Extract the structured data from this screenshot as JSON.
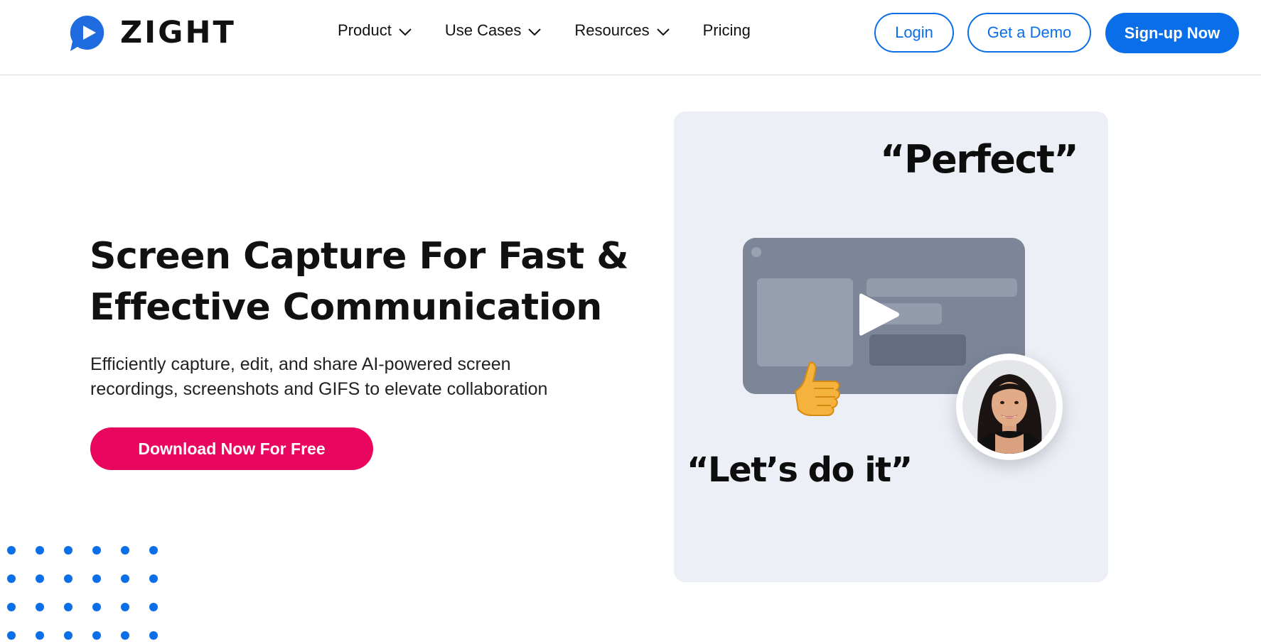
{
  "brand": {
    "name": "ZIGHT",
    "logo_icon": "zight-play-bubble-icon",
    "accent": "#0a6ee8",
    "cta_color": "#e8065f"
  },
  "nav": {
    "items": [
      {
        "label": "Product",
        "has_dropdown": true
      },
      {
        "label": "Use Cases",
        "has_dropdown": true
      },
      {
        "label": "Resources",
        "has_dropdown": true
      },
      {
        "label": "Pricing",
        "has_dropdown": false
      }
    ],
    "chevron_icon": "chevron-down-icon"
  },
  "header_actions": {
    "login": "Login",
    "demo": "Get a Demo",
    "signup": "Sign-up Now"
  },
  "hero": {
    "title_line1": "Screen Capture For Fast &",
    "title_line2": "Effective Communication",
    "subtitle_line1": "Efficiently capture, edit, and share AI-powered screen",
    "subtitle_line2": "recordings, screenshots and GIFS to elevate collaboration",
    "cta": "Download Now For Free"
  },
  "illustration": {
    "quote_top": "“Perfect”",
    "quote_bottom": "“Let’s do it”",
    "play_icon": "play-icon",
    "reaction_icon": "thumbs-up-icon",
    "avatar": "presenter-avatar"
  },
  "decoration": {
    "dot_grid_icon": "dot-grid-decoration"
  }
}
